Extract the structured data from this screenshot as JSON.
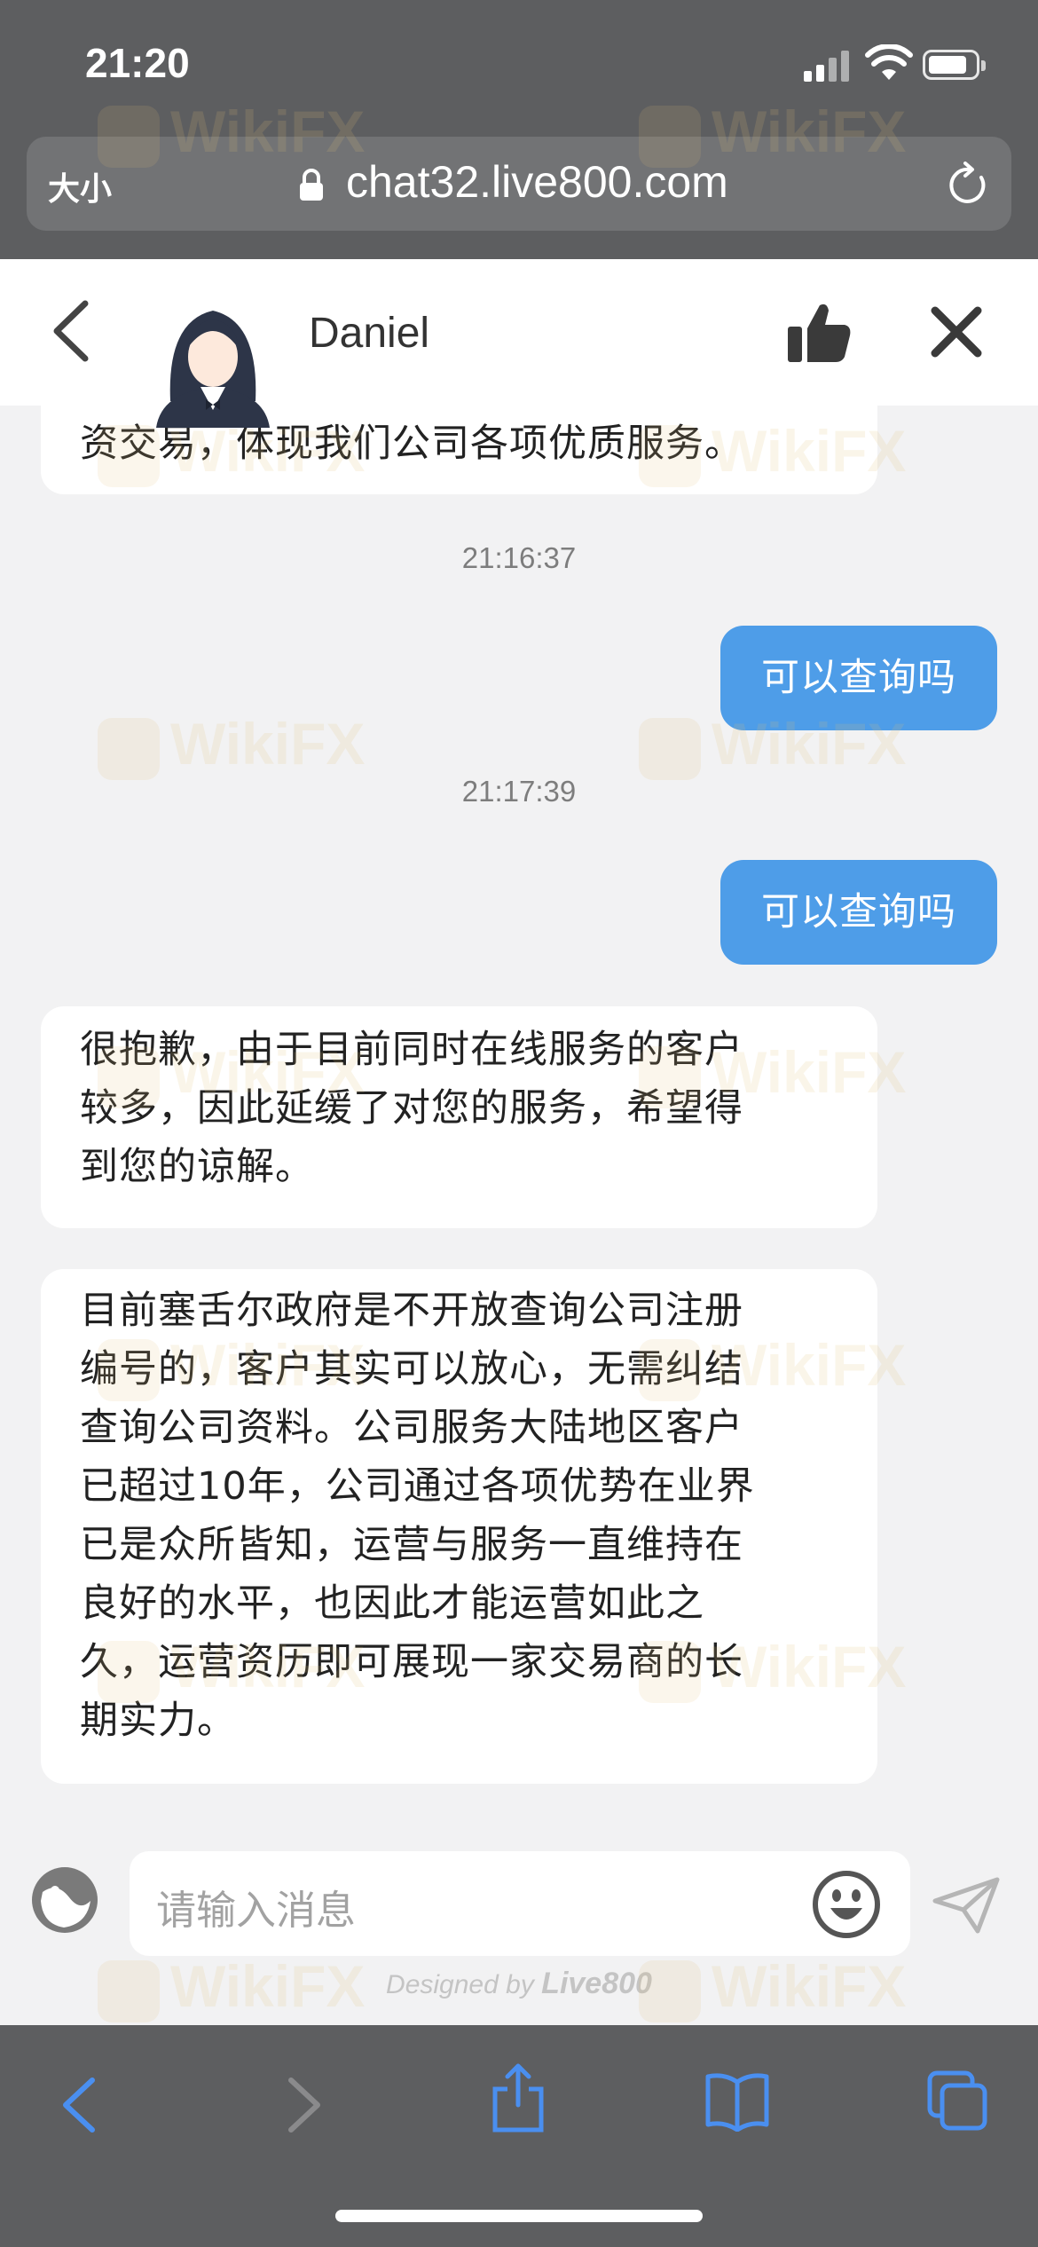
{
  "status": {
    "time": "21:20"
  },
  "browser": {
    "text_size_label": "大小",
    "url": "chat32.live800.com"
  },
  "header": {
    "agent_name": "Daniel"
  },
  "messages": [
    {
      "role": "agent",
      "text": "资交易，体现我们公司各项优质服务。"
    },
    {
      "role": "time",
      "text": "21:16:37"
    },
    {
      "role": "user",
      "text": "可以查询吗"
    },
    {
      "role": "time",
      "text": "21:17:39"
    },
    {
      "role": "user",
      "text": "可以查询吗"
    },
    {
      "role": "agent",
      "lines": [
        "很抱歉，由于目前同时在线服务的客户",
        "较多，因此延缓了对您的服务，希望得",
        "到您的谅解。"
      ]
    },
    {
      "role": "agent",
      "lines": [
        "目前塞舌尔政府是不开放查询公司注册",
        "编号的，客户其实可以放心，无需纠结",
        "查询公司资料。公司服务大陆地区客户",
        "已超过10年，公司通过各项优势在业界",
        "已是众所皆知，运营与服务一直维持在",
        "良好的水平，也因此才能运营如此之",
        "久，运营资历即可展现一家交易商的长",
        "期实力。"
      ]
    }
  ],
  "input": {
    "placeholder": "请输入消息"
  },
  "footer": {
    "designed_by": "Designed by",
    "brand": "Live800"
  },
  "watermark": "WikiFX",
  "colors": {
    "user_bubble": "#4e9de8",
    "toolbar_icons": "#4a8ff0",
    "chrome": "#5d5e60"
  }
}
